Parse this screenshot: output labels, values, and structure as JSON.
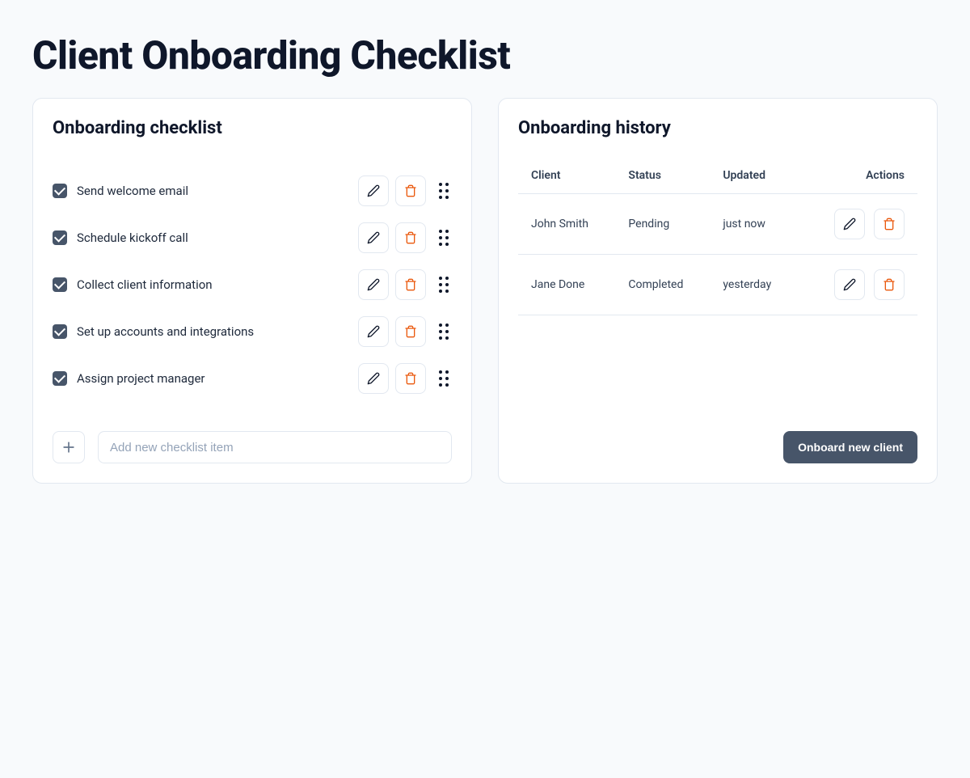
{
  "page": {
    "title": "Client Onboarding Checklist"
  },
  "checklist": {
    "title": "Onboarding checklist",
    "items": [
      {
        "label": "Send welcome email",
        "checked": true
      },
      {
        "label": "Schedule kickoff call",
        "checked": true
      },
      {
        "label": "Collect client information",
        "checked": true
      },
      {
        "label": "Set up accounts and integrations",
        "checked": true
      },
      {
        "label": "Assign project manager",
        "checked": true
      }
    ],
    "add_placeholder": "Add new checklist item"
  },
  "history": {
    "title": "Onboarding history",
    "columns": {
      "client": "Client",
      "status": "Status",
      "updated": "Updated",
      "actions": "Actions"
    },
    "rows": [
      {
        "client": "John Smith",
        "status": "Pending",
        "updated": "just now"
      },
      {
        "client": "Jane Done",
        "status": "Completed",
        "updated": "yesterday"
      }
    ],
    "onboard_button": "Onboard new client"
  },
  "icons": {
    "pencil": "pencil-icon",
    "trash": "trash-icon",
    "drag": "drag-handle-icon",
    "plus": "plus-icon"
  }
}
